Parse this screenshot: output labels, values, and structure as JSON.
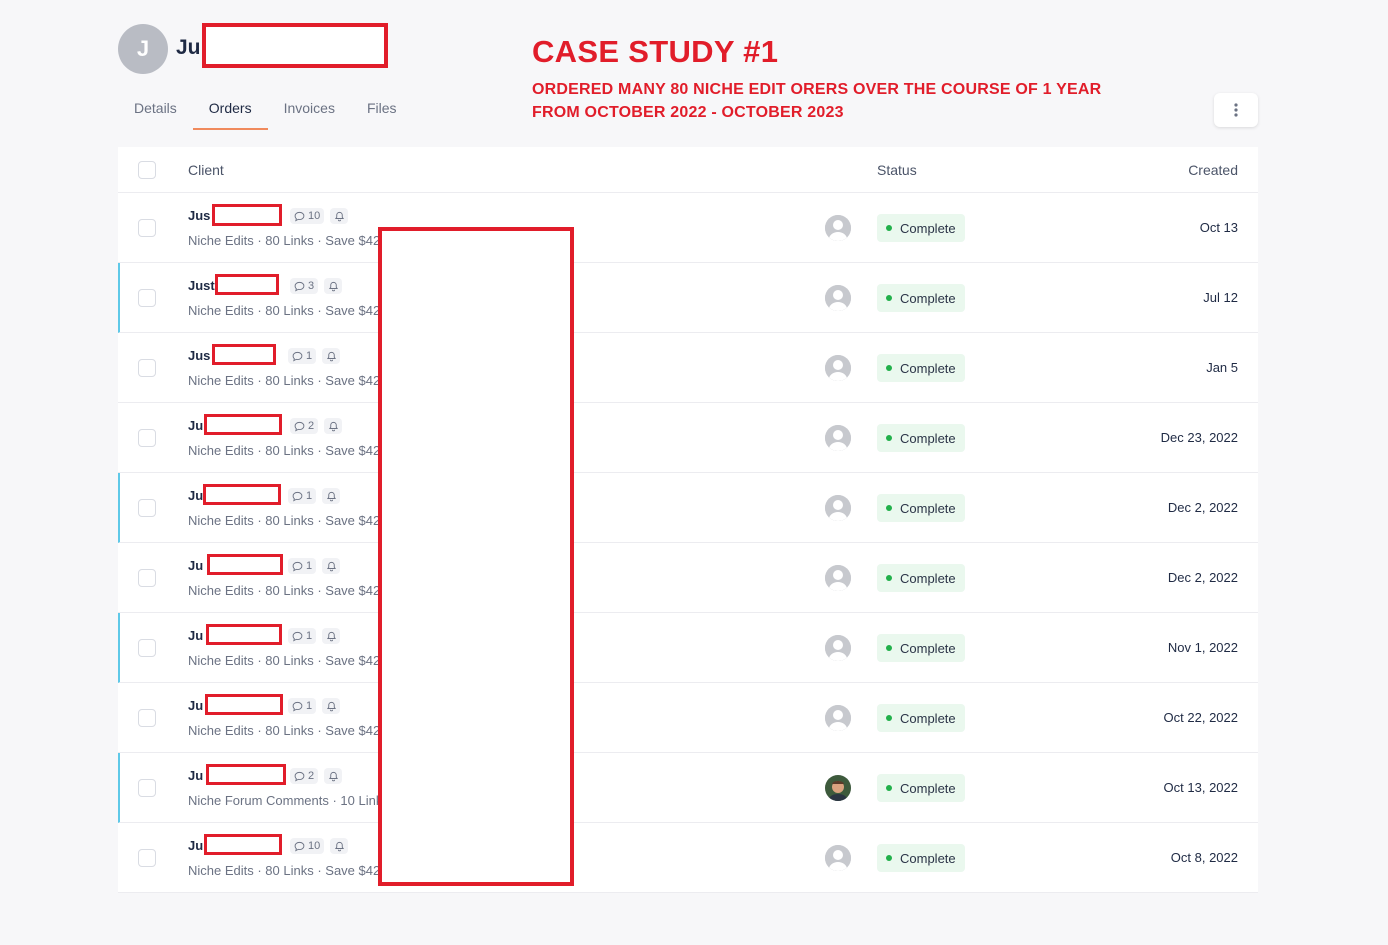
{
  "header": {
    "avatar_initial": "J",
    "client_name": "Ju"
  },
  "annotation": {
    "title": "CASE STUDY #1",
    "line1": "ORDERED MANY 80 NICHE EDIT ORERS OVER THE COURSE OF 1 YEAR",
    "line2": "FROM OCTOBER 2022 - OCTOBER 2023",
    "color": "#e11d2a"
  },
  "tabs": [
    {
      "label": "Details",
      "active": false
    },
    {
      "label": "Orders",
      "active": true
    },
    {
      "label": "Invoices",
      "active": false
    },
    {
      "label": "Files",
      "active": false
    }
  ],
  "table": {
    "columns": {
      "client": "Client",
      "status": "Status",
      "created": "Created"
    },
    "rows": [
      {
        "name": "Jus",
        "comments": "10",
        "desc": "Niche Edits · 80 Links · Save $421",
        "status": "Complete",
        "created": "Oct 13",
        "accent": false,
        "avatar": "default"
      },
      {
        "name": "Just",
        "comments": "3",
        "desc": "Niche Edits · 80 Links · Save $421",
        "status": "Complete",
        "created": "Jul 12",
        "accent": true,
        "avatar": "default"
      },
      {
        "name": "Jus",
        "comments": "1",
        "desc": "Niche Edits · 80 Links · Save $421",
        "status": "Complete",
        "created": "Jan 5",
        "accent": false,
        "avatar": "default"
      },
      {
        "name": "Ju",
        "comments": "2",
        "desc": "Niche Edits · 80 Links · Save $421",
        "status": "Complete",
        "created": "Dec 23, 2022",
        "accent": false,
        "avatar": "default"
      },
      {
        "name": "Ju",
        "comments": "1",
        "desc": "Niche Edits · 80 Links · Save $421",
        "status": "Complete",
        "created": "Dec 2, 2022",
        "accent": true,
        "avatar": "default"
      },
      {
        "name": "Ju",
        "comments": "1",
        "desc": "Niche Edits · 80 Links · Save $421",
        "status": "Complete",
        "created": "Dec 2, 2022",
        "accent": false,
        "avatar": "default"
      },
      {
        "name": "Ju",
        "comments": "1",
        "desc": "Niche Edits · 80 Links · Save $421",
        "status": "Complete",
        "created": "Nov 1, 2022",
        "accent": true,
        "avatar": "default"
      },
      {
        "name": "Ju",
        "comments": "1",
        "desc": "Niche Edits · 80 Links · Save $421",
        "status": "Complete",
        "created": "Oct 22, 2022",
        "accent": false,
        "avatar": "default"
      },
      {
        "name": "Ju",
        "comments": "2",
        "desc": "Niche Forum Comments · 10 Links",
        "status": "Complete",
        "created": "Oct 13, 2022",
        "accent": true,
        "avatar": "photo"
      },
      {
        "name": "Ju",
        "comments": "10",
        "desc": "Niche Edits · 80 Links · Save $421",
        "status": "Complete",
        "created": "Oct 8, 2022",
        "accent": false,
        "avatar": "default"
      }
    ]
  }
}
